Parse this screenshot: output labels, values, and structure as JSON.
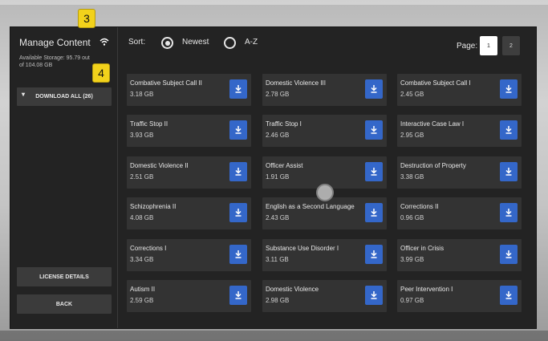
{
  "sidebar": {
    "title": "Manage Content",
    "storage": "Available Storage: 95.79 out of 104.08 GB",
    "download_all": "DOWNLOAD ALL (26)",
    "license_details": "LICENSE DETAILS",
    "back": "BACK",
    "wifi_icon": "wifi-icon"
  },
  "annotations": [
    "3",
    "4"
  ],
  "sort": {
    "label": "Sort:",
    "options": [
      "Newest",
      "A-Z"
    ],
    "selected": "Newest"
  },
  "pagination": {
    "label": "Page:",
    "pages": [
      "1",
      "2"
    ],
    "current": "1"
  },
  "items": [
    {
      "name": "Combative Subject Call II",
      "size": "3.18 GB"
    },
    {
      "name": "Domestic Violence III",
      "size": "2.78 GB"
    },
    {
      "name": "Combative Subject Call I",
      "size": "2.45 GB"
    },
    {
      "name": "Traffic Stop II",
      "size": "3.93 GB"
    },
    {
      "name": "Traffic Stop I",
      "size": "2.46 GB"
    },
    {
      "name": "Interactive Case Law I",
      "size": "2.95 GB"
    },
    {
      "name": "Domestic Violence II",
      "size": "2.51 GB"
    },
    {
      "name": "Officer Assist",
      "size": "1.91 GB"
    },
    {
      "name": "Destruction of Property",
      "size": "3.38 GB"
    },
    {
      "name": "Schizophrenia II",
      "size": "4.08 GB"
    },
    {
      "name": "English as a Second Language",
      "size": "2.43 GB"
    },
    {
      "name": "Corrections II",
      "size": "0.96 GB"
    },
    {
      "name": "Corrections I",
      "size": "3.34 GB"
    },
    {
      "name": "Substance Use Disorder I",
      "size": "3.11 GB"
    },
    {
      "name": "Officer in Crisis",
      "size": "3.99 GB"
    },
    {
      "name": "Autism II",
      "size": "2.59 GB"
    },
    {
      "name": "Domestic Violence",
      "size": "2.98 GB"
    },
    {
      "name": "Peer Intervention I",
      "size": "0.97 GB"
    }
  ],
  "colors": {
    "accent": "#3467c9",
    "badge": "#f2d21b"
  }
}
